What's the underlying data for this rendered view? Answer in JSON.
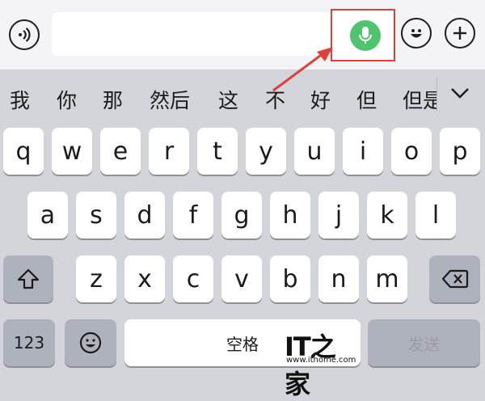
{
  "toolbar": {
    "voice_toggle_icon": "voice-wave-icon",
    "text_field_value": "",
    "mic_icon": "microphone-icon",
    "emoji_icon": "emoji-face-icon",
    "add_icon": "plus-icon",
    "mic_color": "#4ec46f",
    "highlight_color": "#e0403a"
  },
  "candidates": {
    "items": [
      "我",
      "你",
      "那",
      "然后",
      "这",
      "不",
      "好",
      "但",
      "但是"
    ],
    "expand_icon": "chevron-down-icon"
  },
  "keyboard": {
    "row1": [
      "q",
      "w",
      "e",
      "r",
      "t",
      "y",
      "u",
      "i",
      "o",
      "p"
    ],
    "row2": [
      "a",
      "s",
      "d",
      "f",
      "g",
      "h",
      "j",
      "k",
      "l"
    ],
    "row3": [
      "z",
      "x",
      "c",
      "v",
      "b",
      "n",
      "m"
    ],
    "shift_icon": "shift-arrow-icon",
    "delete_icon": "backspace-icon",
    "numbers_label": "123",
    "emoji_key_icon": "emoji-face-icon",
    "space_label": "空格",
    "send_label": "发送"
  },
  "watermark": {
    "logo": "IT之家",
    "url": "www.ithome.com"
  }
}
